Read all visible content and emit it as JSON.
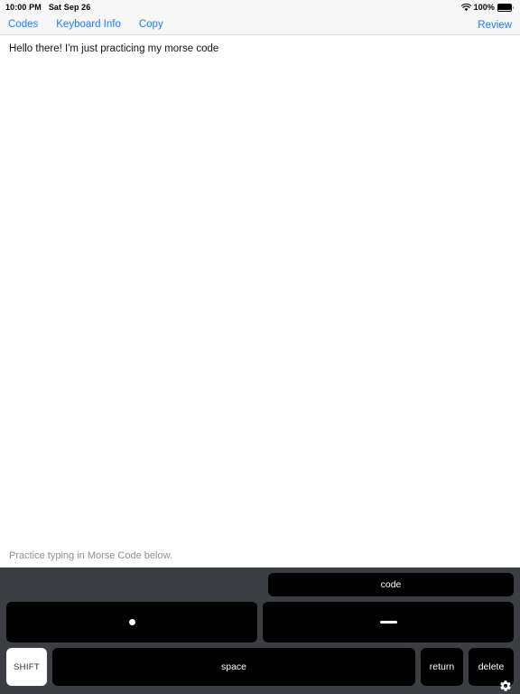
{
  "statusbar": {
    "time": "10:00 PM",
    "date": "Sat Sep 26",
    "battery_percent": "100%",
    "wifi_icon": "wifi-icon",
    "battery_icon": "battery-full-icon"
  },
  "toolbar": {
    "codes_label": "Codes",
    "keyboard_info_label": "Keyboard Info",
    "copy_label": "Copy",
    "review_label": "Review",
    "accent_color": "#1a7afb"
  },
  "document": {
    "text": "Hello there! I'm just practicing my morse code"
  },
  "hint": {
    "text": "Practice typing in Morse Code below."
  },
  "keyboard": {
    "background_color": "#3b3f44",
    "key_color": "#000000",
    "key_text_color": "#ffffff",
    "code_label": "code",
    "dot_label": "•",
    "dash_label": "—",
    "shift_label": "SHIFT",
    "shift_active": true,
    "space_label": "space",
    "return_label": "return",
    "delete_label": "delete",
    "settings_icon": "gear-icon"
  }
}
